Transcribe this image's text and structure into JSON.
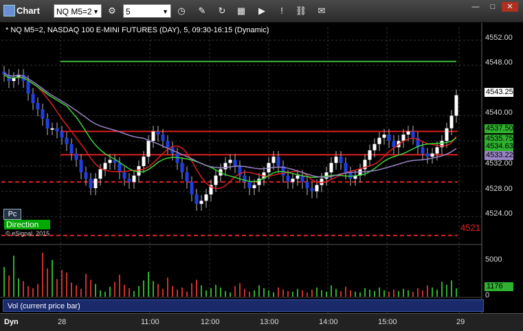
{
  "window": {
    "title": "Chart",
    "symbol": "NQ M5=2",
    "interval": "5",
    "buttons": [
      "cursor-icon",
      "chart-type-icon",
      "draw-icon",
      "refresh-icon",
      "studies-icon",
      "play-icon",
      "alert-icon",
      "link-icon",
      "comment-icon"
    ],
    "min": "—",
    "max": "□",
    "close": "✕"
  },
  "chart_info": "* NQ M5=2, NASDAQ 100 E-MINI FUTURES (DAY), 5, 09:30-16:15 (Dynamic)",
  "price_axis": {
    "labels": [
      "4552.00",
      "4548.00",
      "4544.00",
      "4540.00",
      "4536.00",
      "4532.00",
      "4528.00",
      "4524.00"
    ],
    "tags": [
      {
        "text": "4543.25",
        "bg": "#ffffff",
        "fg": "#000000"
      },
      {
        "text": "4537.50",
        "bg": "#2fb12f",
        "fg": "#000000"
      },
      {
        "text": "4535.75",
        "bg": "#2fb12f",
        "fg": "#000000"
      },
      {
        "text": "4534.63",
        "bg": "#2fb12f",
        "fg": "#000000"
      },
      {
        "text": "4533.22",
        "bg": "#9a84c8",
        "fg": "#000000"
      }
    ]
  },
  "overlay": {
    "pc": "Pc",
    "direction": "Direction",
    "copyright": "© eSignal, 2015",
    "level": "4521"
  },
  "volume": {
    "title": "Vol (current price bar)",
    "labels": [
      "5000",
      "0"
    ],
    "current": "1176"
  },
  "time_axis": {
    "dyn": "Dyn",
    "labels": [
      "28",
      "11:00",
      "12:00",
      "13:00",
      "14:00",
      "15:00",
      "29"
    ]
  },
  "chart_data": {
    "type": "candlestick",
    "title": "NQ M5=2",
    "ylim": [
      4520,
      4554
    ],
    "closes": [
      4546.5,
      4545.5,
      4546,
      4546.5,
      4545.5,
      4543.5,
      4542,
      4541,
      4539.5,
      4538,
      4538,
      4537.5,
      4536.5,
      4535.5,
      4534,
      4533,
      4531,
      4530,
      4528.5,
      4530,
      4531.5,
      4532.5,
      4533,
      4532.5,
      4531,
      4530,
      4529.5,
      4530.5,
      4532,
      4533.5,
      4536,
      4537.5,
      4537,
      4536,
      4535,
      4534,
      4532.5,
      4531,
      4529.5,
      4527.5,
      4526,
      4526.5,
      4527.5,
      4529,
      4530.5,
      4531.5,
      4532.5,
      4533,
      4532,
      4530.5,
      4529.5,
      4528.5,
      4529,
      4530,
      4531,
      4532.5,
      4533.5,
      4532,
      4530.5,
      4529.5,
      4530,
      4530.5,
      4529.5,
      4528.5,
      4528,
      4529,
      4530,
      4531,
      4532.5,
      4533.5,
      4532.5,
      4531,
      4530,
      4530.5,
      4531.5,
      4533,
      4534.5,
      4535.5,
      4536.5,
      4537,
      4536,
      4535,
      4536,
      4537,
      4537.5,
      4536.5,
      4535,
      4534,
      4533.5,
      4534,
      4535,
      4536,
      4538,
      4540,
      4543.25
    ],
    "volumes": [
      4200,
      3000,
      5800,
      2600,
      2200,
      1500,
      1200,
      1800,
      6200,
      4000,
      5200,
      2500,
      3800,
      3400,
      2000,
      1600,
      1100,
      3200,
      2400,
      1800,
      900,
      700,
      1400,
      2100,
      3100,
      1700,
      1200,
      800,
      1500,
      2300,
      3500,
      2200,
      1800,
      1100,
      2700,
      1500,
      1000,
      1300,
      700,
      1900,
      2400,
      1600,
      900,
      1200,
      1700,
      1300,
      800,
      600,
      1500,
      1900,
      1100,
      700,
      900,
      1600,
      1200,
      900,
      600,
      1300,
      1000,
      800,
      700,
      1100,
      900,
      600,
      1000,
      1300,
      900,
      700,
      1600,
      1100,
      800,
      1400,
      900,
      700,
      600,
      1200,
      1000,
      800,
      1300,
      900,
      700,
      1000,
      800,
      1100,
      900,
      700,
      1200,
      900,
      1600,
      1300,
      1000,
      2100,
      1700,
      2300,
      1176
    ],
    "lines": [
      {
        "name": "",
        "color": "#e02020",
        "level": 4537.5
      },
      {
        "name": "",
        "color": "#e02020",
        "level": 4533.8
      },
      {
        "name": "",
        "color": "#3fc43f",
        "level": 4548.6
      },
      {
        "name": "",
        "color": "#e02020",
        "level": 4529.5,
        "dashed": true
      },
      {
        "name": "",
        "color": "#e02020",
        "level": 4521,
        "dashed": true
      }
    ]
  }
}
